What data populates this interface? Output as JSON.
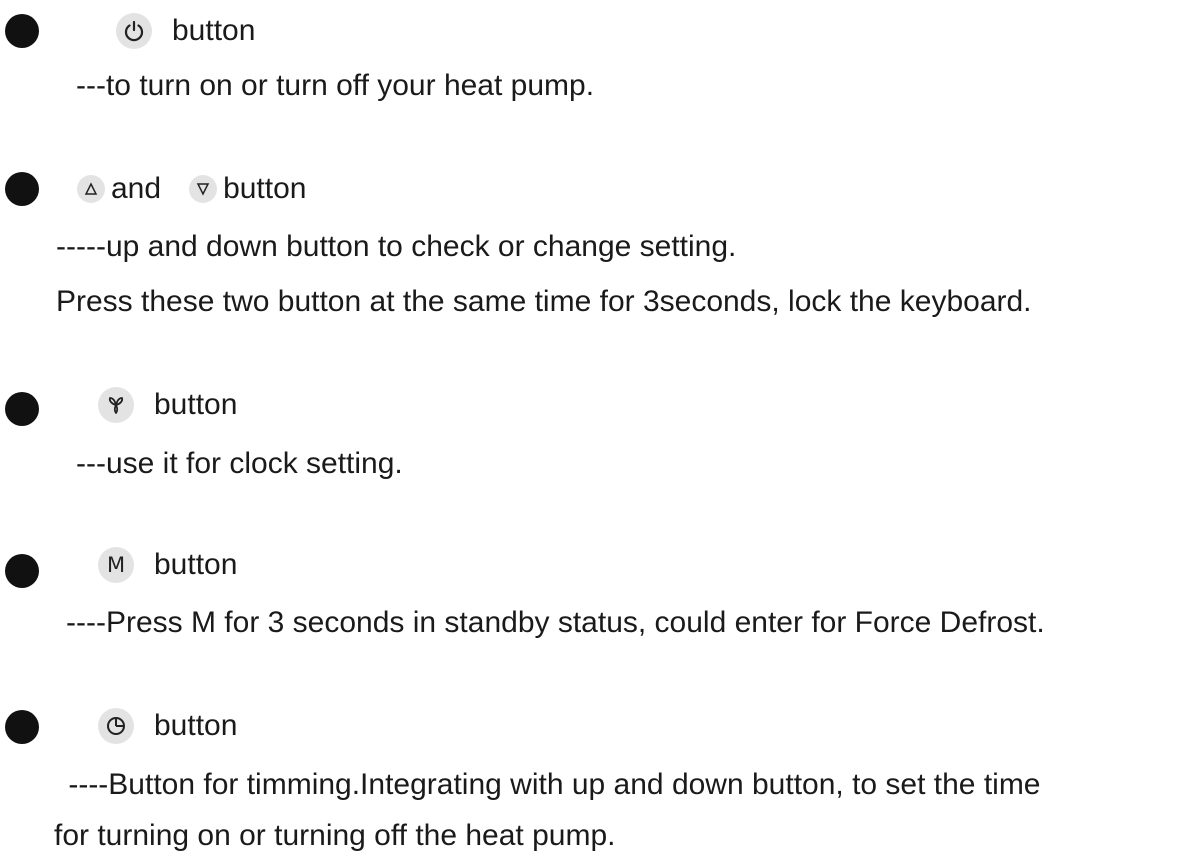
{
  "items": [
    {
      "icon": "power-icon",
      "label": "button",
      "lines": [
        "---to turn on or turn off your heat pump."
      ]
    },
    {
      "icon": "up-arrow-icon",
      "icon2": "down-arrow-icon",
      "and_text": "and",
      "label": "button",
      "lines": [
        "-----up and down button to check or change setting.",
        "Press these two button at the same time for 3seconds, lock the keyboard."
      ]
    },
    {
      "icon": "fan-icon",
      "label": "button",
      "lines": [
        "---use it for clock setting."
      ]
    },
    {
      "icon": "mode-icon",
      "icon_text": "M",
      "label": "button",
      "lines": [
        "----Press M for 3 seconds in standby status, could enter for Force Defrost."
      ]
    },
    {
      "icon": "clock-icon",
      "label": "button",
      "lines": [
        " ----Button for timming.Integrating with up and down button, to set the time",
        "for turning on or turning off the heat pump."
      ]
    }
  ]
}
